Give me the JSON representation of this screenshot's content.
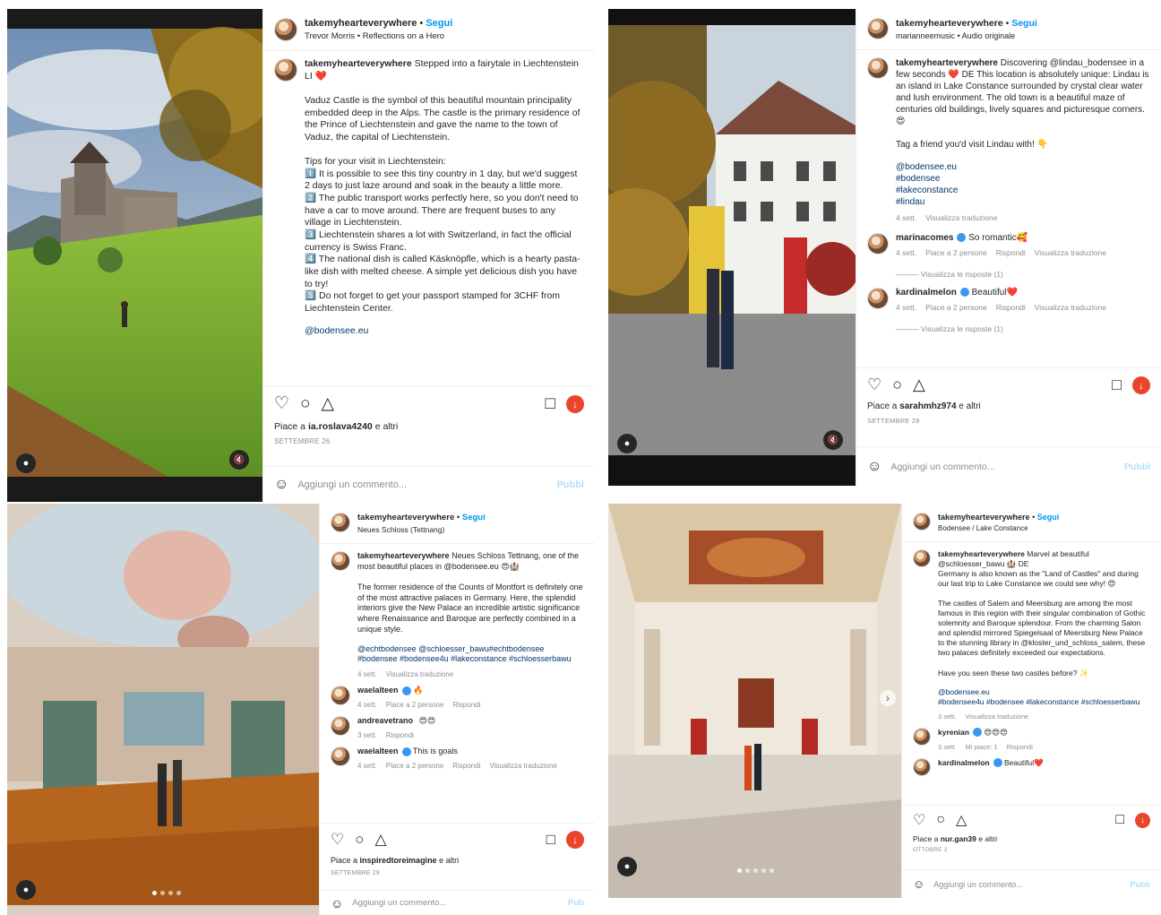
{
  "icons": {
    "heart": "heart-icon",
    "comment": "comment-icon",
    "share": "paper-plane-icon",
    "save": "bookmark-icon",
    "download": "download-icon",
    "emoji": "smiley-icon",
    "user": "user-tag-icon",
    "mute": "muted-speaker-icon"
  },
  "colors": {
    "accent": "#0095f6",
    "download": "#e8452c",
    "heart": "#e0245e",
    "verified": "#3897f0"
  },
  "posts": [
    {
      "username": "takemyhearteverywhere",
      "follow_label": "Segui",
      "dot": "•",
      "subtitle": "Trevor Morris • Reflections on a Hero",
      "caption": "Stepped into a fairytale in Liechtenstein LI ❤️\n\nVaduz Castle is the symbol of this beautiful mountain principality embedded deep in the Alps. The castle is the primary residence of the Prince of Liechtenstein and gave the name to the town of Vaduz, the capital of Liechtenstein.\n\nTips for your visit in Liechtenstein:\n1️⃣ It is possible to see this tiny country in 1 day, but we'd suggest 2 days to just laze around and soak in the beauty a little more.\n2️⃣ The public transport works perfectly here, so you don't need to have a car to move around. There are frequent buses to any village in Liechtenstein.\n3️⃣ Liechtenstein shares a lot with Switzerland, in fact the official currency is Swiss Franc.\n4️⃣ The national dish is called Käsknöpfle, which is a hearty pasta-like dish with melted cheese. A simple yet delicious dish you have to try!\n5️⃣ Do not forget to get your passport stamped for 3CHF from Liechtenstein Center.",
      "tags": "@bodensee.eu",
      "likes_prefix": "Piace a",
      "likes_user": "ia.roslava4240",
      "likes_suffix": "e altri",
      "date": "SETTEMBRE 26",
      "comment_placeholder": "Aggiungi un commento...",
      "post_label": "Pubbl",
      "comments": []
    },
    {
      "username": "takemyhearteverywhere",
      "follow_label": "Segui",
      "dot": "•",
      "subtitle": "marianneemusic • Audio originale",
      "caption": "Discovering @lindau_bodensee in a few seconds ❤️ DE This location is absolutely unique: Lindau is an island in Lake Constance surrounded by crystal clear water and lush environment. The old town is a beautiful maze of centuries old buildings, lively squares and picturesque corners. 😍\n\nTag a friend you'd visit Lindau with! 👇",
      "tags": "@bodensee.eu\n#bodensee\n#lakeconstance\n#lindau",
      "caption_time": "4 sett.",
      "caption_translate": "Visualizza traduzione",
      "likes_prefix": "Piace a",
      "likes_user": "sarahmhz974",
      "likes_suffix": "e altri",
      "date": "SETTEMBRE 28",
      "comment_placeholder": "Aggiungi un commento...",
      "post_label": "Pubbl",
      "comments": [
        {
          "user": "marinacomes",
          "text": "So romantic🥰",
          "time": "4 sett.",
          "likes": "Piace a 2 persone",
          "reply": "Rispondi",
          "translate": "Visualizza traduzione",
          "view_replies": "Visualizza le risposte (1)"
        },
        {
          "user": "kardinalmelon",
          "text": "Beautiful❤️",
          "time": "4 sett.",
          "likes": "Piace a 2 persone",
          "reply": "Rispondi",
          "translate": "Visualizza traduzione",
          "view_replies": "Visualizza le risposte (1)"
        }
      ]
    },
    {
      "username": "takemyhearteverywhere",
      "follow_label": "Segui",
      "dot": "•",
      "subtitle": "Neues Schloss (Tettnang)",
      "caption": "Neues Schloss Tettnang, one of the most beautiful places in @bodensee.eu 😍🏰\n\nThe former residence of the Counts of Montfort is definitely one of the most attractive palaces in Germany. Here, the splendid interiors give the New Palace an incredible artistic significance where Renaissance and Baroque are perfectly combined in a unique style.",
      "tags": "@echtbodensee @schloesser_bawu#echtbodensee #bodensee #bodensee4u #lakeconstance #schloesserbawu",
      "caption_time": "4 sett.",
      "caption_translate": "Visualizza traduzione",
      "likes_prefix": "Piace a",
      "likes_user": "inspiredtoreimagine",
      "likes_suffix": "e altri",
      "date": "SETTEMBRE 29",
      "comment_placeholder": "Aggiungi un commento...",
      "post_label": "Pub",
      "comments": [
        {
          "user": "waelalteen",
          "text": "🔥",
          "time": "4 sett.",
          "likes": "Piace a 2 persone",
          "reply": "Rispondi",
          "translate": ""
        },
        {
          "user": "andreavetrano",
          "text": "😍😍",
          "time": "3 sett.",
          "likes": "",
          "reply": "Rispondi",
          "translate": ""
        },
        {
          "user": "waelalteen",
          "text": "This is goals",
          "time": "4 sett.",
          "likes": "Piace a 2 persone",
          "reply": "Rispondi",
          "translate": "Visualizza traduzione"
        }
      ]
    },
    {
      "username": "takemyhearteverywhere",
      "follow_label": "Segui",
      "dot": "•",
      "subtitle": "Bodensee / Lake Constance",
      "caption": "Marvel at beautiful @schloesser_bawu 🏰 DE\nGermany is also known as the \"Land of Castles\" and during our last trip to Lake Constance we could see why! 😍\n\nThe castles of Salem and Meersburg are among the most famous in this region with their singular combination of Gothic solemnity and Baroque splendour. From the charming Salon and splendid mirrored Spiegelsaal of Meersburg New Palace to the stunning library in @kloster_und_schloss_salem, these two palaces definitely exceeded our expectations.\n\nHave you seen these two castles before? ✨",
      "tags": "@bodensee.eu\n#bodensee4u #bodensee #lakeconstance #schloesserbawu",
      "caption_time": "3 sett.",
      "caption_translate": "Visualizza traduzione",
      "likes_prefix": "Piace a",
      "likes_user": "nur.gan39",
      "likes_suffix": "e altri",
      "date": "OTTOBRE 2",
      "comment_placeholder": "Aggiungi un commento...",
      "post_label": "Pubb",
      "comments": [
        {
          "user": "kyrenian",
          "text": "😍😍😍",
          "time": "3 sett.",
          "likes": "Mi piace: 1",
          "reply": "Rispondi",
          "translate": ""
        },
        {
          "user": "kardinalmelon",
          "text": "Beautiful❤️",
          "time": "",
          "likes": "",
          "reply": "",
          "translate": ""
        }
      ]
    }
  ]
}
